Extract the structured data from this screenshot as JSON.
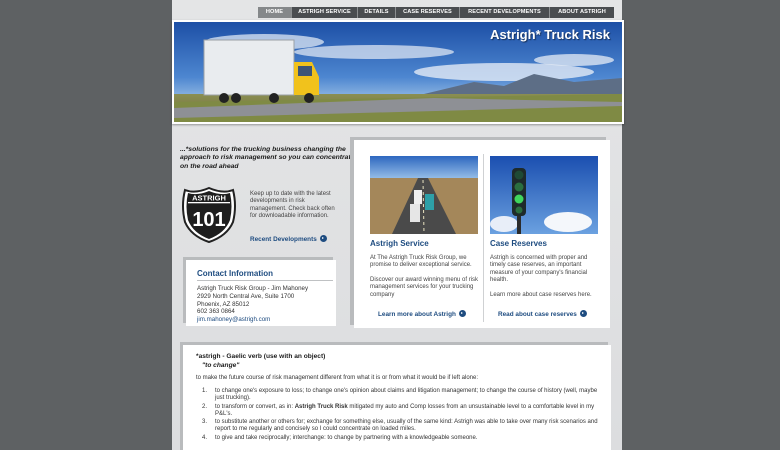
{
  "nav": {
    "items": [
      {
        "label": "HOME",
        "active": true
      },
      {
        "label": "ASTRIGH SERVICE",
        "active": false
      },
      {
        "label": "DETAILS",
        "active": false
      },
      {
        "label": "CASE RESERVES",
        "active": false
      },
      {
        "label": "RECENT DEVELOPMENTS",
        "active": false
      },
      {
        "label": "ABOUT ASTRIGH",
        "active": false
      }
    ]
  },
  "banner": {
    "title": "Astrigh* Truck Risk"
  },
  "tagline": "...*solutions for the trucking business changing the approach to risk management so you can concentrate on the road ahead",
  "news": {
    "shield_top": "ASTRIGH",
    "shield_number": "101",
    "text": "Keep up to date with the latest developments in risk management. Check back often for downloadable information.",
    "link": "Recent Developments"
  },
  "contact": {
    "heading": "Contact Information",
    "lines": [
      "Astrigh Truck Risk Group - Jim Mahoney",
      "2929 North Central Ave, Suite 1700",
      "Phoenix, AZ 85012",
      "602 363 0864"
    ],
    "email": "jim.mahoney@astrigh.com"
  },
  "services": [
    {
      "title": "Astrigh Service",
      "paragraphs": [
        "At The Astrigh Truck Risk Group, we promise to deliver exceptional service.",
        "Discover our award winning menu of risk management services for your trucking company"
      ],
      "link": "Learn more about Astrigh"
    },
    {
      "title": "Case Reserves",
      "paragraphs": [
        "Astrigh is concerned with proper and timely case reserves, an important measure of your company's financial health.",
        "Learn more about case reserves here."
      ],
      "link": "Read about case reserves"
    }
  ],
  "definition": {
    "term": "*astrigh - Gaelic verb (use with an object)",
    "sub": "\"to change\"",
    "intro": "to make the future course of risk management different from what it is or from what it would be if left alone:",
    "items": [
      {
        "num": "1.",
        "text": "to change one's exposure to loss; to change one's opinion about claims and litigation management; to change the course of history (well, maybe just trucking)."
      },
      {
        "num": "2.",
        "pre": "to transform or convert, as in: ",
        "bold": "Astrigh Truck Risk",
        "post": " mitigated my auto and Comp losses from an unsustainable level to a comfortable level in my P&L's."
      },
      {
        "num": "3.",
        "text": "to substitute another or others for; exchange for something else, usually of the same kind: Astrigh was able to take over many risk scenarios and report to me regularly and concisely so I could concentrate on loaded miles."
      },
      {
        "num": "4.",
        "text": "to give and take reciprocally; interchange: to change by partnering with a knowledgeable someone."
      }
    ]
  },
  "colors": {
    "accent": "#1e4c80",
    "nav": "#4a4d50",
    "background": "#5e6163"
  }
}
